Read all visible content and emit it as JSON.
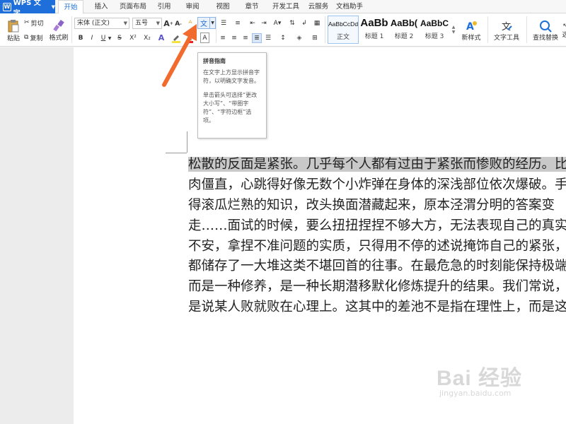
{
  "app": {
    "name": "WPS 文字"
  },
  "tabs": [
    {
      "label": "开始",
      "active": true
    },
    {
      "label": "插入"
    },
    {
      "label": "页面布局"
    },
    {
      "label": "引用"
    },
    {
      "label": "审阅"
    },
    {
      "label": "视图"
    },
    {
      "label": "章节"
    },
    {
      "label": "开发工具"
    },
    {
      "label": "云服务"
    },
    {
      "label": "文档助手"
    }
  ],
  "ribbon": {
    "paste": "粘贴",
    "cut": "剪切",
    "copy": "复制",
    "format_painter": "格式刷",
    "font_name": "宋体 (正文)",
    "font_size": "五号",
    "bold": "B",
    "italic": "I",
    "underline": "U",
    "strike": "S",
    "superscript": "X²",
    "subscript": "X₂",
    "font_color": "A",
    "char_border": "A",
    "grow_font": "A",
    "shrink_font": "A",
    "phonetic": "文",
    "styles": [
      {
        "sample": "AaBbCcDd",
        "name": "正文"
      },
      {
        "sample": "AaBb",
        "name": "标题 1"
      },
      {
        "sample": "AaBb(",
        "name": "标题 2"
      },
      {
        "sample": "AaBbC",
        "name": "标题 3"
      }
    ],
    "new_style": "新样式",
    "text_tools": "文字工具",
    "find_replace": "查找替换",
    "select": "选"
  },
  "tooltip": {
    "title": "拼音指南",
    "desc": "在文字上方显示拼音字符，以明确文字发音。",
    "hint": "单击箭头可选择“更改大小写”、“带圈字符”、“字符边框”选项。"
  },
  "document": {
    "lines": [
      {
        "selected": "松散的反面是紧张。几乎每个人都有过由于紧张而惨败的经历。比",
        "rest": ""
      },
      {
        "selected": "",
        "rest": "肉僵直，心跳得好像无数个小炸弹在身体的深浅部位依次爆破。手"
      },
      {
        "selected": "",
        "rest": "得滚瓜烂熟的知识，改头换面潜藏起来，原本泾渭分明的答案变"
      },
      {
        "selected": "",
        "rest": "走……面试的时候，要么扭扭捏捏不够大方，无法表现自己的真实"
      },
      {
        "selected": "",
        "rest": "不安，拿捏不准问题的实质，只得用不停的述说掩饰自己的紧张，"
      },
      {
        "selected": "",
        "rest": "都储存了一大堆这类不堪回首的往事。在最危急的时刻能保持极端"
      },
      {
        "selected": "",
        "rest": "而是一种修养，是一种长期潜移默化修炼提升的结果。我们常说，"
      },
      {
        "selected": "",
        "rest": "是说某人败就败在心理上。这其中的差池不是指在理性上，而是这"
      }
    ]
  },
  "watermark": {
    "brand": "Bai 经验",
    "url": "jingyan.baidu.com"
  },
  "colors": {
    "accent": "#1e6fd9",
    "arrow": "#f26b2e",
    "selection": "#c9c9c9"
  }
}
